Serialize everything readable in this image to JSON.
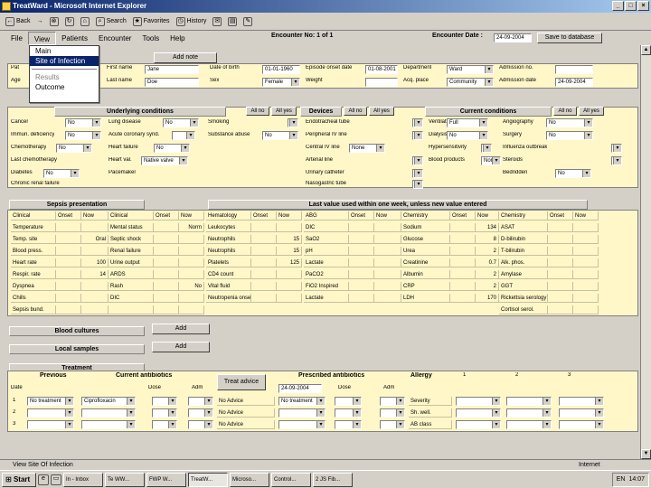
{
  "window": {
    "title": "TreatWard - Microsoft Internet Explorer",
    "min": "_",
    "max": "□",
    "close": "×"
  },
  "toolbar": {
    "back": "Back",
    "forward": "→",
    "stop": "⊗",
    "refresh": "↻",
    "home": "⌂",
    "search": "Search",
    "favorites": "Favorites",
    "history": "History"
  },
  "menu": {
    "file": "File",
    "view": "View",
    "patients": "Patients",
    "encounter": "Encounter",
    "tools": "Tools",
    "help": "Help"
  },
  "view_menu": {
    "items": [
      "Main",
      "Site of Infection",
      "Results",
      "Outcome"
    ]
  },
  "encounter": {
    "number": "Encounter No: 1 of 1",
    "date_label": "Encounter Date :",
    "date": "24-09-2004",
    "save": "Save to database"
  },
  "patient": {
    "add_note": "Add note",
    "labels": [
      "Pat",
      "Age",
      "First name",
      "Last name",
      "Date of birth",
      "Sex",
      "Episode onset date",
      "Weight",
      "Department",
      "Acq. place",
      "Admission no.",
      "Admission date"
    ],
    "first_name": "Jane",
    "last_name": "Doe",
    "dob": "01-01-1960",
    "sex": "Female",
    "onset_date": "01-08-2001",
    "department": "Ward",
    "acq_place": "Community",
    "admission_date": "24-09-2004"
  },
  "underlying": {
    "title": "Underlying conditions",
    "all_no": "All no",
    "all_yes": "All yes",
    "rows": [
      [
        "Cancer",
        "No"
      ],
      [
        "Immun. deficiency",
        "No"
      ],
      [
        "Chemotherapy",
        "No"
      ],
      [
        "Last chemotherapy",
        ""
      ],
      [
        "Diabetes",
        "No"
      ],
      [
        "Chronic renal failure",
        ""
      ]
    ],
    "rows2": [
      [
        "Lung disease",
        "No"
      ],
      [
        "Acute coronary synd.",
        ""
      ],
      [
        "Heart failure",
        "No"
      ],
      [
        "Heart val.",
        "Native valve"
      ],
      [
        "Pacemaker",
        ""
      ]
    ],
    "rows3": [
      [
        "Smoking",
        ""
      ],
      [
        "Substance abuse",
        "No"
      ]
    ]
  },
  "devices": {
    "title": "Devices",
    "all_no": "All no",
    "all_yes": "All yes",
    "rows": [
      [
        "Endotracheal tube",
        ""
      ],
      [
        "Peripheral IV line",
        ""
      ],
      [
        "Central IV line",
        "None"
      ],
      [
        "Arterial line",
        ""
      ],
      [
        "Urinary catheter",
        ""
      ],
      [
        "Nasogastric tube",
        ""
      ]
    ]
  },
  "current": {
    "title": "Current conditions",
    "all_no": "All no",
    "all_yes": "All yes",
    "rows": [
      [
        "Ventilation",
        "Full"
      ],
      [
        "Dialysis",
        "No"
      ],
      [
        "Hypersensitivity",
        ""
      ],
      [
        "Blood products",
        "None"
      ]
    ],
    "rows2": [
      [
        "Angiography",
        "No"
      ],
      [
        "Surgery",
        "No"
      ],
      [
        "Influenza outbreak",
        ""
      ],
      [
        "Steroids",
        ""
      ],
      [
        "Bedridden",
        "No"
      ]
    ]
  },
  "sepsis": {
    "title": "Sepsis presentation",
    "headers": [
      "Clinical",
      "Onset",
      "Now",
      "Clinical",
      "Onset",
      "Now"
    ],
    "rows": [
      [
        "Temperature",
        "",
        "",
        "Mental status",
        "",
        "Norm"
      ],
      [
        "Temp. site",
        "",
        "Oral",
        "Septic shock",
        "",
        ""
      ],
      [
        "Blood press.",
        "",
        "",
        "Renal failure",
        "",
        ""
      ],
      [
        "Heart rate",
        "",
        "100",
        "Urine output",
        "",
        ""
      ],
      [
        "Respir. rate",
        "",
        "14",
        "ARDS",
        "",
        ""
      ],
      [
        "Dyspnea",
        "",
        "",
        "Rash",
        "",
        "No"
      ],
      [
        "Chills",
        "",
        "",
        "DIC",
        "",
        ""
      ],
      [
        "Sepsis bund.",
        "",
        "",
        "",
        "",
        ""
      ]
    ]
  },
  "lab": {
    "title": "Last value used within one week, unless new value entered",
    "headers": [
      "Hematology",
      "Onset",
      "Now",
      "ABG",
      "Onset",
      "Now",
      "Chemistry",
      "Onset",
      "Now",
      "Chemistry",
      "Onset",
      "Now"
    ],
    "hema": [
      [
        "Leukocytes",
        "",
        ""
      ],
      [
        "Neutrophils",
        "",
        "15"
      ],
      [
        "Neutrophils",
        "",
        "15"
      ],
      [
        "Platelets",
        "",
        "125"
      ],
      [
        "CD4 count",
        "",
        ""
      ],
      [
        "Vital fluid",
        "",
        ""
      ],
      [
        "Neutropenia onset",
        "",
        ""
      ]
    ],
    "abg": [
      [
        "DIC",
        "",
        ""
      ],
      [
        "SaO2",
        "",
        ""
      ],
      [
        "pH",
        "",
        ""
      ],
      [
        "Lactate",
        "",
        ""
      ],
      [
        "PaCO2",
        "",
        ""
      ],
      [
        "FiO2 Inspired",
        "",
        ""
      ],
      [
        "Lactate",
        "",
        ""
      ]
    ],
    "chem1": [
      [
        "Sodium",
        "",
        "134"
      ],
      [
        "Glucose",
        "",
        "8"
      ],
      [
        "Urea",
        "",
        "2"
      ],
      [
        "Creatinine",
        "",
        "0.7"
      ],
      [
        "Albumin",
        "",
        "2"
      ],
      [
        "CRP",
        "",
        "2"
      ],
      [
        "LDH",
        "",
        "170"
      ]
    ],
    "chem2": [
      [
        "ASAT",
        "",
        ""
      ],
      [
        "D-bilirubin",
        "",
        ""
      ],
      [
        "T-bilirubin",
        "",
        ""
      ],
      [
        "Alk. phos.",
        "",
        ""
      ],
      [
        "Amylase",
        "",
        ""
      ],
      [
        "GGT",
        "",
        ""
      ],
      [
        "Rickettsia serology",
        "",
        ""
      ],
      [
        "Cortisol serol.",
        "",
        ""
      ]
    ]
  },
  "blood": {
    "title": "Blood cultures",
    "add": "Add"
  },
  "local": {
    "title": "Local samples",
    "add": "Add"
  },
  "treatment": {
    "title": "Treatment",
    "previous": "Previous",
    "current_ab": "Current antibiotics",
    "prescribed": "Prescribed antibiotics",
    "allergy": "Allergy",
    "treat_advice": "Treat advice",
    "date_lbl": "Date",
    "dose_lbl": "Dose",
    "adm_lbl": "Adm",
    "cols": [
      "1",
      "2",
      "3"
    ],
    "prescribed_date": "24-09-2004",
    "rows": [
      {
        "n": "1",
        "prev": "No treatment",
        "cur": "Ciprofloxacin",
        "adv": "No Advice",
        "presc": "No treatment",
        "allergy": "Severity"
      },
      {
        "n": "2",
        "prev": "",
        "cur": "",
        "adv": "No Advice",
        "presc": "",
        "allergy": "Sh. well."
      },
      {
        "n": "3",
        "prev": "",
        "cur": "",
        "adv": "No Advice",
        "presc": "",
        "allergy": "AB class"
      }
    ]
  },
  "status": {
    "text": "View Site Of Infection",
    "zone": "Internet"
  },
  "taskbar": {
    "start": "Start",
    "tasks": [
      "In - Inbox",
      "Te WW...",
      "FWP W...",
      "TreatW...",
      "Microso...",
      "Control...",
      "2 JS Fib..."
    ],
    "lang": "EN",
    "time": "14:07"
  }
}
